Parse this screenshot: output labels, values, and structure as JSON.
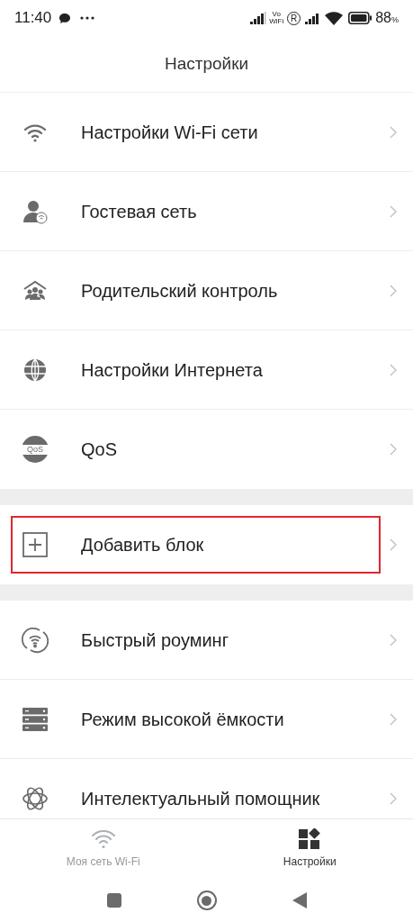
{
  "status_bar": {
    "time": "11:40",
    "vowifi_top": "Vo",
    "vowifi_bottom": "WiFi",
    "roaming": "R",
    "battery": "88",
    "battery_unit": "%"
  },
  "header": {
    "title": "Настройки"
  },
  "groups": [
    {
      "items": [
        {
          "kind": "wifi",
          "label": "Настройки Wi-Fi сети",
          "highlighted": false
        },
        {
          "kind": "guest",
          "label": "Гостевая сеть",
          "highlighted": false
        },
        {
          "kind": "parental",
          "label": "Родительский контроль",
          "highlighted": false
        },
        {
          "kind": "internet",
          "label": "Настройки Интернета",
          "highlighted": false
        },
        {
          "kind": "qos",
          "label": "QoS",
          "icon_label": "QoS",
          "highlighted": false
        }
      ]
    },
    {
      "items": [
        {
          "kind": "add",
          "label": "Добавить блок",
          "highlighted": true
        }
      ]
    },
    {
      "items": [
        {
          "kind": "roaming",
          "label": "Быстрый роуминг",
          "highlighted": false
        },
        {
          "kind": "capacity",
          "label": "Режим высокой ёмкости",
          "highlighted": false
        },
        {
          "kind": "assistant",
          "label": "Интелектуальный помощник",
          "highlighted": false
        }
      ]
    }
  ],
  "bottom_nav": [
    {
      "kind": "wifi",
      "label": "Моя сеть Wi-Fi",
      "selected": false
    },
    {
      "kind": "settings",
      "label": "Настройки",
      "selected": true
    }
  ]
}
